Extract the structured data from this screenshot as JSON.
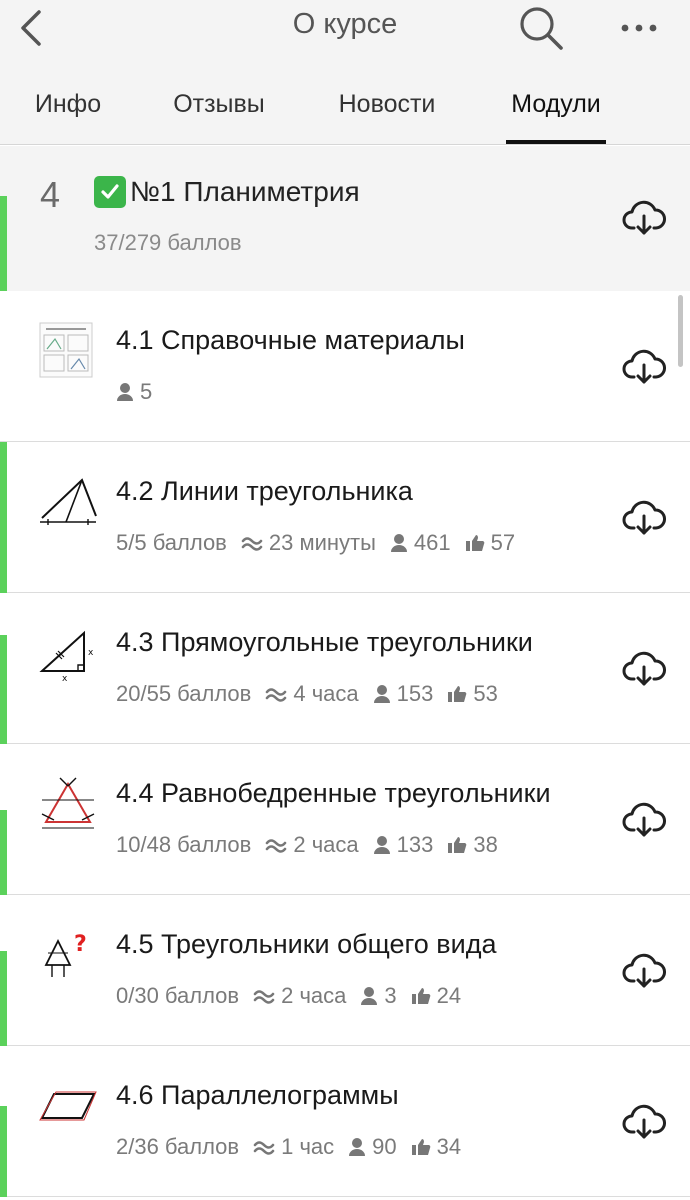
{
  "header": {
    "title": "О курсе"
  },
  "tabs": [
    {
      "label": "Инфо",
      "active": false
    },
    {
      "label": "Отзывы",
      "active": false
    },
    {
      "label": "Новости",
      "active": false
    },
    {
      "label": "Модули",
      "active": true
    }
  ],
  "module": {
    "number": "4",
    "title": "№1 Планиметрия",
    "points": "37/279 баллов",
    "completed": true
  },
  "lessons": [
    {
      "title": "4.1 Справочные материалы",
      "points": "",
      "time": "",
      "learners": "5",
      "likes": "",
      "progress": "none"
    },
    {
      "title": "4.2 Линии треугольника",
      "points": "5/5 баллов",
      "time": "23 минуты",
      "learners": "461",
      "likes": "57",
      "progress": "full"
    },
    {
      "title": "4.3 Прямоугольные треугольники",
      "points": "20/55 баллов",
      "time": "4 часа",
      "learners": "153",
      "likes": "53",
      "progress": "partial"
    },
    {
      "title": "4.4 Равнобедренные треугольники",
      "points": "10/48 баллов",
      "time": "2 часа",
      "learners": "133",
      "likes": "38",
      "progress": "partial"
    },
    {
      "title": "4.5 Треугольники общего вида",
      "points": "0/30 баллов",
      "time": "2 часа",
      "learners": "3",
      "likes": "24",
      "progress": "partial"
    },
    {
      "title": "4.6 Параллелограммы",
      "points": "2/36 баллов",
      "time": "1 час",
      "learners": "90",
      "likes": "34",
      "progress": "partial"
    }
  ],
  "colors": {
    "progress": "#5bd15b",
    "header_bg": "#f4f4f4",
    "meta_text": "#7a7a7a"
  },
  "icons": {
    "back": "chevron-left-icon",
    "search": "search-icon",
    "more": "more-icon",
    "download": "cloud-download-icon",
    "user": "user-icon",
    "like": "thumbs-up-icon",
    "duration": "approx-icon"
  }
}
